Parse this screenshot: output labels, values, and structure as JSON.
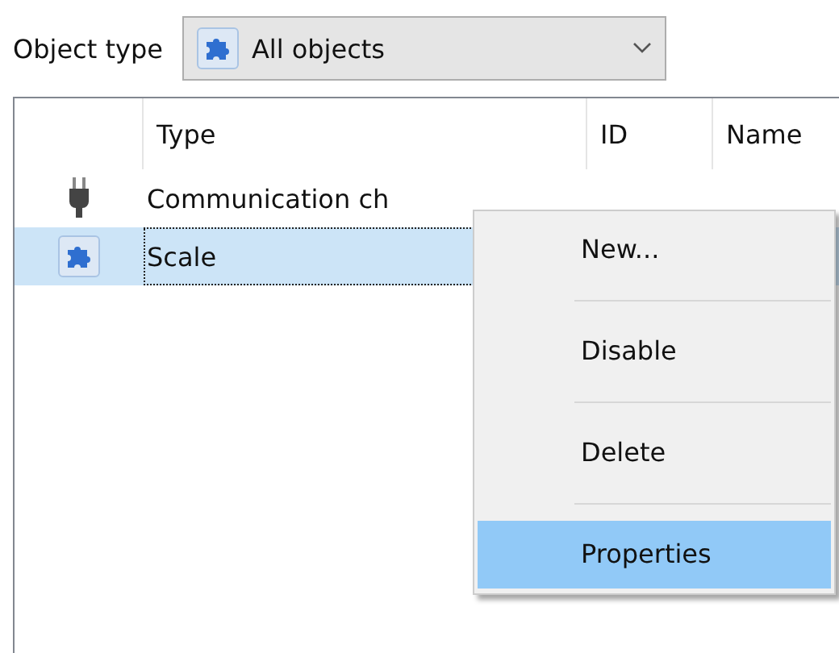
{
  "filter": {
    "label": "Object type",
    "value": "All objects"
  },
  "table": {
    "columns": [
      "Type",
      "ID",
      "Name"
    ],
    "rows": [
      {
        "kind": "plug",
        "type": "Communication ch",
        "selected": false
      },
      {
        "kind": "puzzle",
        "type": "Scale",
        "selected": true
      }
    ]
  },
  "context_menu": {
    "items": [
      {
        "label": "New...",
        "selected": false
      },
      {
        "label": "Disable",
        "selected": false
      },
      {
        "label": "Delete",
        "selected": false
      },
      {
        "label": "Properties",
        "selected": true
      }
    ]
  }
}
